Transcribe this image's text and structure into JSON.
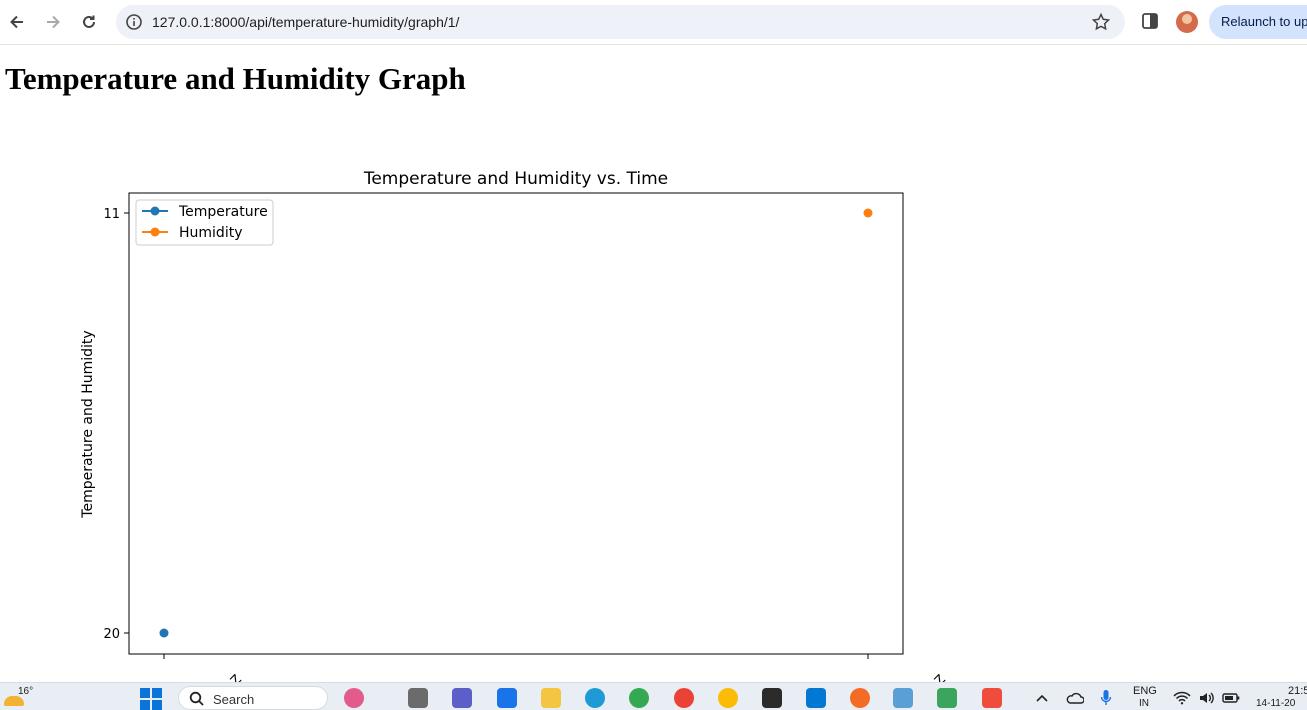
{
  "browser": {
    "url": "127.0.0.1:8000/api/temperature-humidity/graph/1/",
    "relaunch_label": "Relaunch to update"
  },
  "page": {
    "title": "Temperature and Humidity Graph"
  },
  "chart_data": {
    "type": "scatter",
    "title": "Temperature and Humidity vs. Time",
    "xlabel": "",
    "ylabel": "Temperature and Humidity",
    "y_axis": "categorical",
    "y_categories": [
      "20",
      "11"
    ],
    "x": [
      "…Z",
      "…Z"
    ],
    "series": [
      {
        "name": "Temperature",
        "color": "#1f77b4",
        "points": [
          {
            "x": "…Z",
            "y": "20"
          }
        ]
      },
      {
        "name": "Humidity",
        "color": "#ff7f0e",
        "points": [
          {
            "x": "…Z",
            "y": "11"
          }
        ]
      }
    ],
    "legend_position": "upper-left",
    "grid": false
  },
  "taskbar": {
    "weather_temp": "16°",
    "search_label": "Search",
    "language": "ENG",
    "language_region": "IN",
    "time": "21:5",
    "date": "14-11-20"
  }
}
